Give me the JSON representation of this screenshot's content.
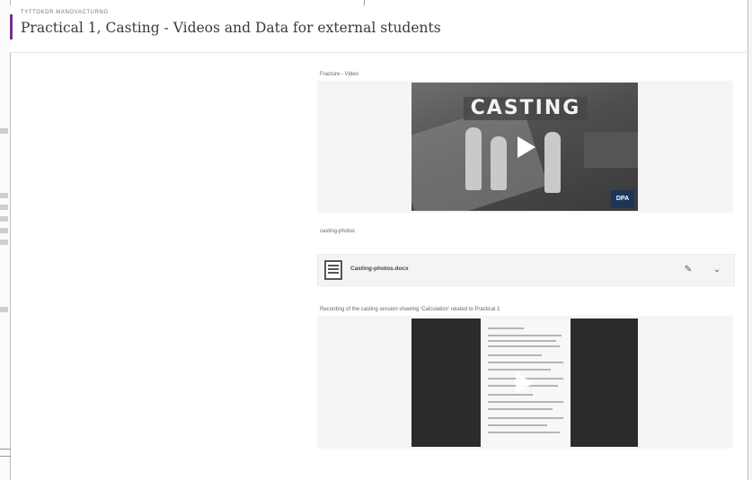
{
  "breadcrumb": "TYTTOKDR MANOVACTURNG",
  "page_title": "Practical 1, Casting - Videos and Data for external students",
  "sections": {
    "video1_label": "Fracture - Video",
    "video1_caption": "CASTING",
    "video1_logo": "DPA",
    "file_label": "casting-photos",
    "file_name": "Casting-photos.docx",
    "video2_label": "Recording of the casting session showing 'Calculation' related to Practical 1"
  },
  "icons": {
    "play": "play-icon",
    "file": "document-file-icon",
    "edit": "pencil-icon",
    "more": "chevron-down-icon"
  },
  "colors": {
    "accent": "#7b2d8e",
    "panel_bg": "#f4f4f4",
    "video_bg": "#2b2b2b"
  }
}
